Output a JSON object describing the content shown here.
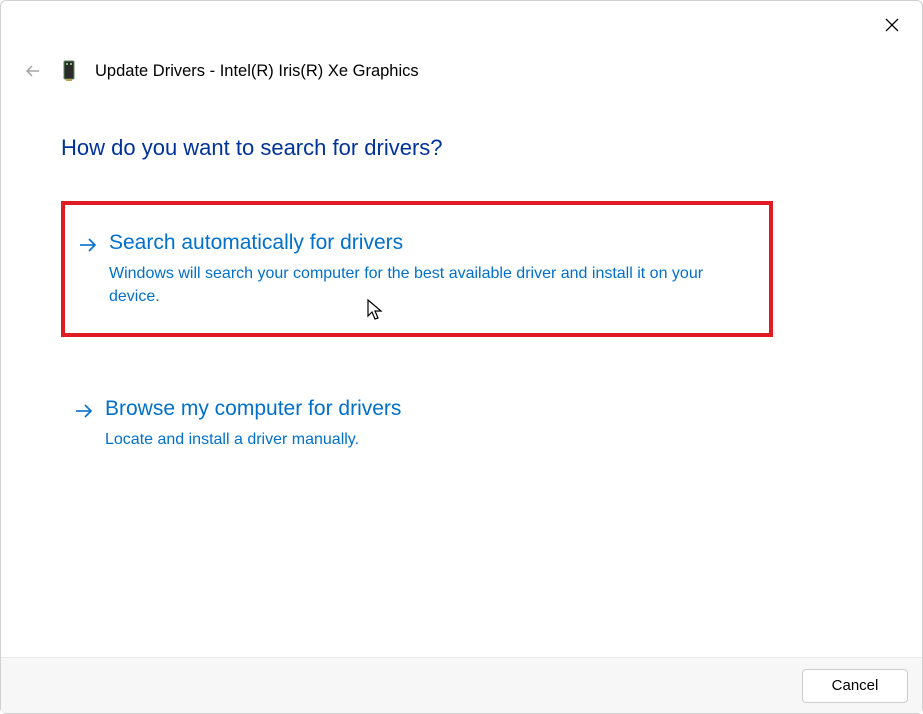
{
  "window": {
    "title": "Update Drivers - Intel(R) Iris(R) Xe Graphics"
  },
  "heading": "How do you want to search for drivers?",
  "options": [
    {
      "title": "Search automatically for drivers",
      "description": "Windows will search your computer for the best available driver and install it on your device."
    },
    {
      "title": "Browse my computer for drivers",
      "description": "Locate and install a driver manually."
    }
  ],
  "footer": {
    "cancel_label": "Cancel"
  }
}
